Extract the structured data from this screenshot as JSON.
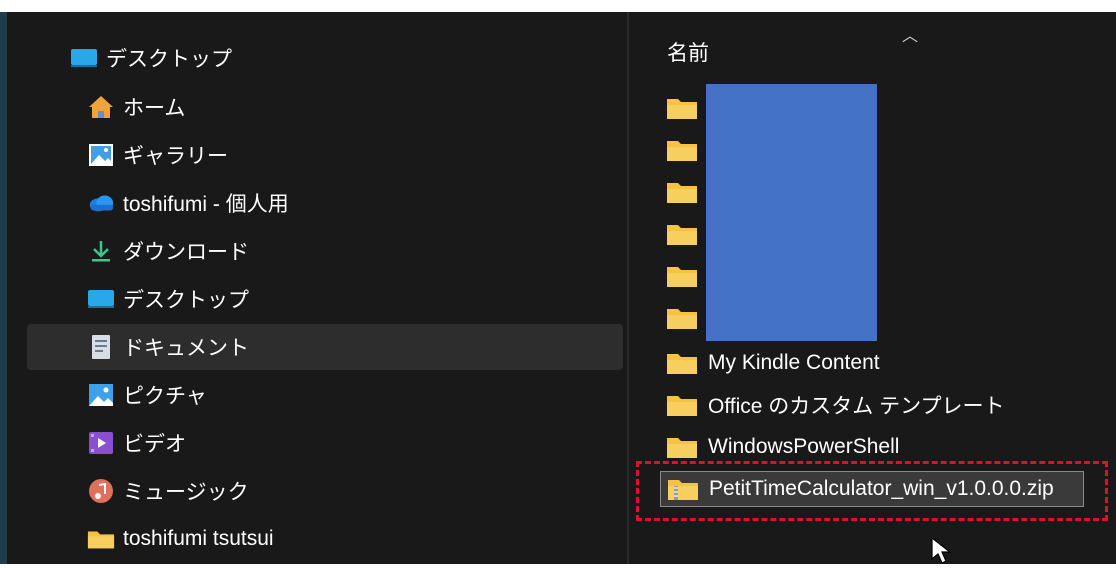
{
  "nav": {
    "items": [
      {
        "label": "デスクトップ",
        "icon": "desktop-icon"
      },
      {
        "label": "ホーム",
        "icon": "home-icon"
      },
      {
        "label": "ギャラリー",
        "icon": "gallery-icon"
      },
      {
        "label": "toshifumi - 個人用",
        "icon": "onedrive-icon"
      },
      {
        "label": "ダウンロード",
        "icon": "download-icon"
      },
      {
        "label": "デスクトップ",
        "icon": "desktop-icon"
      },
      {
        "label": "ドキュメント",
        "icon": "documents-icon",
        "selected": true
      },
      {
        "label": "ピクチャ",
        "icon": "pictures-icon"
      },
      {
        "label": "ビデオ",
        "icon": "videos-icon"
      },
      {
        "label": "ミュージック",
        "icon": "music-icon"
      },
      {
        "label": "toshifumi tsutsui",
        "icon": "folder-icon"
      }
    ]
  },
  "content": {
    "column_header": "名前",
    "files": [
      {
        "name": "",
        "icon": "folder-icon"
      },
      {
        "name": "",
        "icon": "folder-icon"
      },
      {
        "name": "",
        "icon": "folder-icon"
      },
      {
        "name": "",
        "icon": "folder-icon"
      },
      {
        "name": "",
        "icon": "folder-icon"
      },
      {
        "name": "",
        "icon": "folder-icon"
      },
      {
        "name": "My Kindle Content",
        "icon": "folder-icon"
      },
      {
        "name": "Office のカスタム テンプレート",
        "icon": "folder-icon"
      },
      {
        "name": "WindowsPowerShell",
        "icon": "folder-icon"
      },
      {
        "name": "PetitTimeCalculator_win_v1.0.0.0.zip",
        "icon": "zip-folder-icon",
        "selected": true
      }
    ]
  },
  "colors": {
    "background": "#191919",
    "selected": "#2d2d2d",
    "folder": "#f5c242",
    "redaction": "#4472c4",
    "highlight": "#e0102a"
  }
}
